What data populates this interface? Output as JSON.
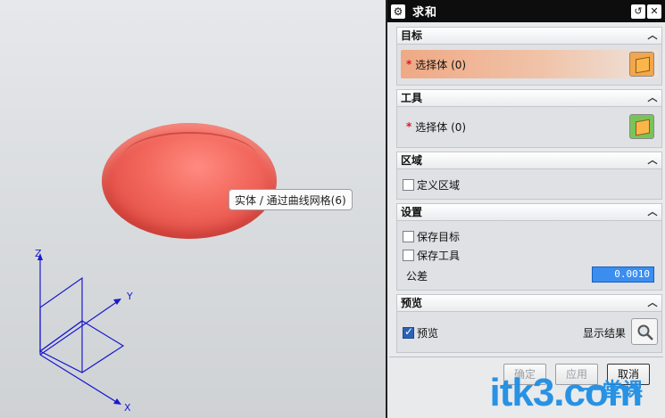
{
  "viewport": {
    "tooltip": "实体 / 通过曲线网格(6)",
    "triad": {
      "z": "Z",
      "y": "Y",
      "x": "X"
    },
    "colors": {
      "body": "#f2675c",
      "triad": "#1a1acc"
    }
  },
  "dialog": {
    "title": "求和",
    "sections": {
      "target": {
        "label": "目标",
        "select_label": "选择体 (0)"
      },
      "tool": {
        "label": "工具",
        "select_label": "选择体 (0)"
      },
      "region": {
        "label": "区域",
        "define_region": "定义区域"
      },
      "settings": {
        "label": "设置",
        "keep_target": "保存目标",
        "keep_tool": "保存工具",
        "tolerance_label": "公差",
        "tolerance_value": "0.0010"
      },
      "preview": {
        "label": "预览",
        "preview_check": "预览",
        "show_result": "显示结果"
      }
    },
    "buttons": {
      "ok": "确定",
      "apply": "应用",
      "cancel": "取消"
    }
  },
  "watermark": {
    "latin": "itk3",
    "cn": "一堂课",
    "suffix": ".com"
  }
}
